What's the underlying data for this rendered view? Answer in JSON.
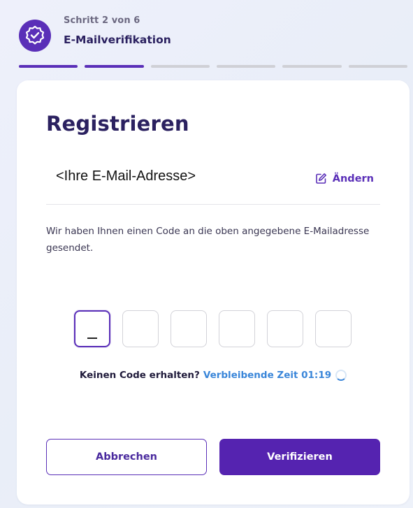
{
  "header": {
    "step_count": "Schritt 2 von 6",
    "step_title": "E-Mailverifikation",
    "step_icon": "verified-badge-icon",
    "progress": {
      "total_steps": 6,
      "active_steps": 2
    }
  },
  "card": {
    "title": "Registrieren",
    "email": "<Ihre E-Mail-Adresse>",
    "change_label": "Ändern",
    "change_icon": "edit-icon",
    "description": "Wir haben Ihnen einen Code an die oben angegebene E-Mailadresse gesendet.",
    "code_inputs": [
      {
        "value": "_"
      },
      {
        "value": ""
      },
      {
        "value": ""
      },
      {
        "value": ""
      },
      {
        "value": ""
      },
      {
        "value": ""
      }
    ],
    "resend": {
      "question": "Keinen Code erhalten?",
      "timer": "Verbleibende Zeit 01:19"
    },
    "cancel_label": "Abbrechen",
    "verify_label": "Verifizieren"
  },
  "colors": {
    "primary": "#5a2fb8",
    "title": "#2b2160",
    "timer": "#3a86d9",
    "progress_inactive": "#cfd0d6"
  }
}
